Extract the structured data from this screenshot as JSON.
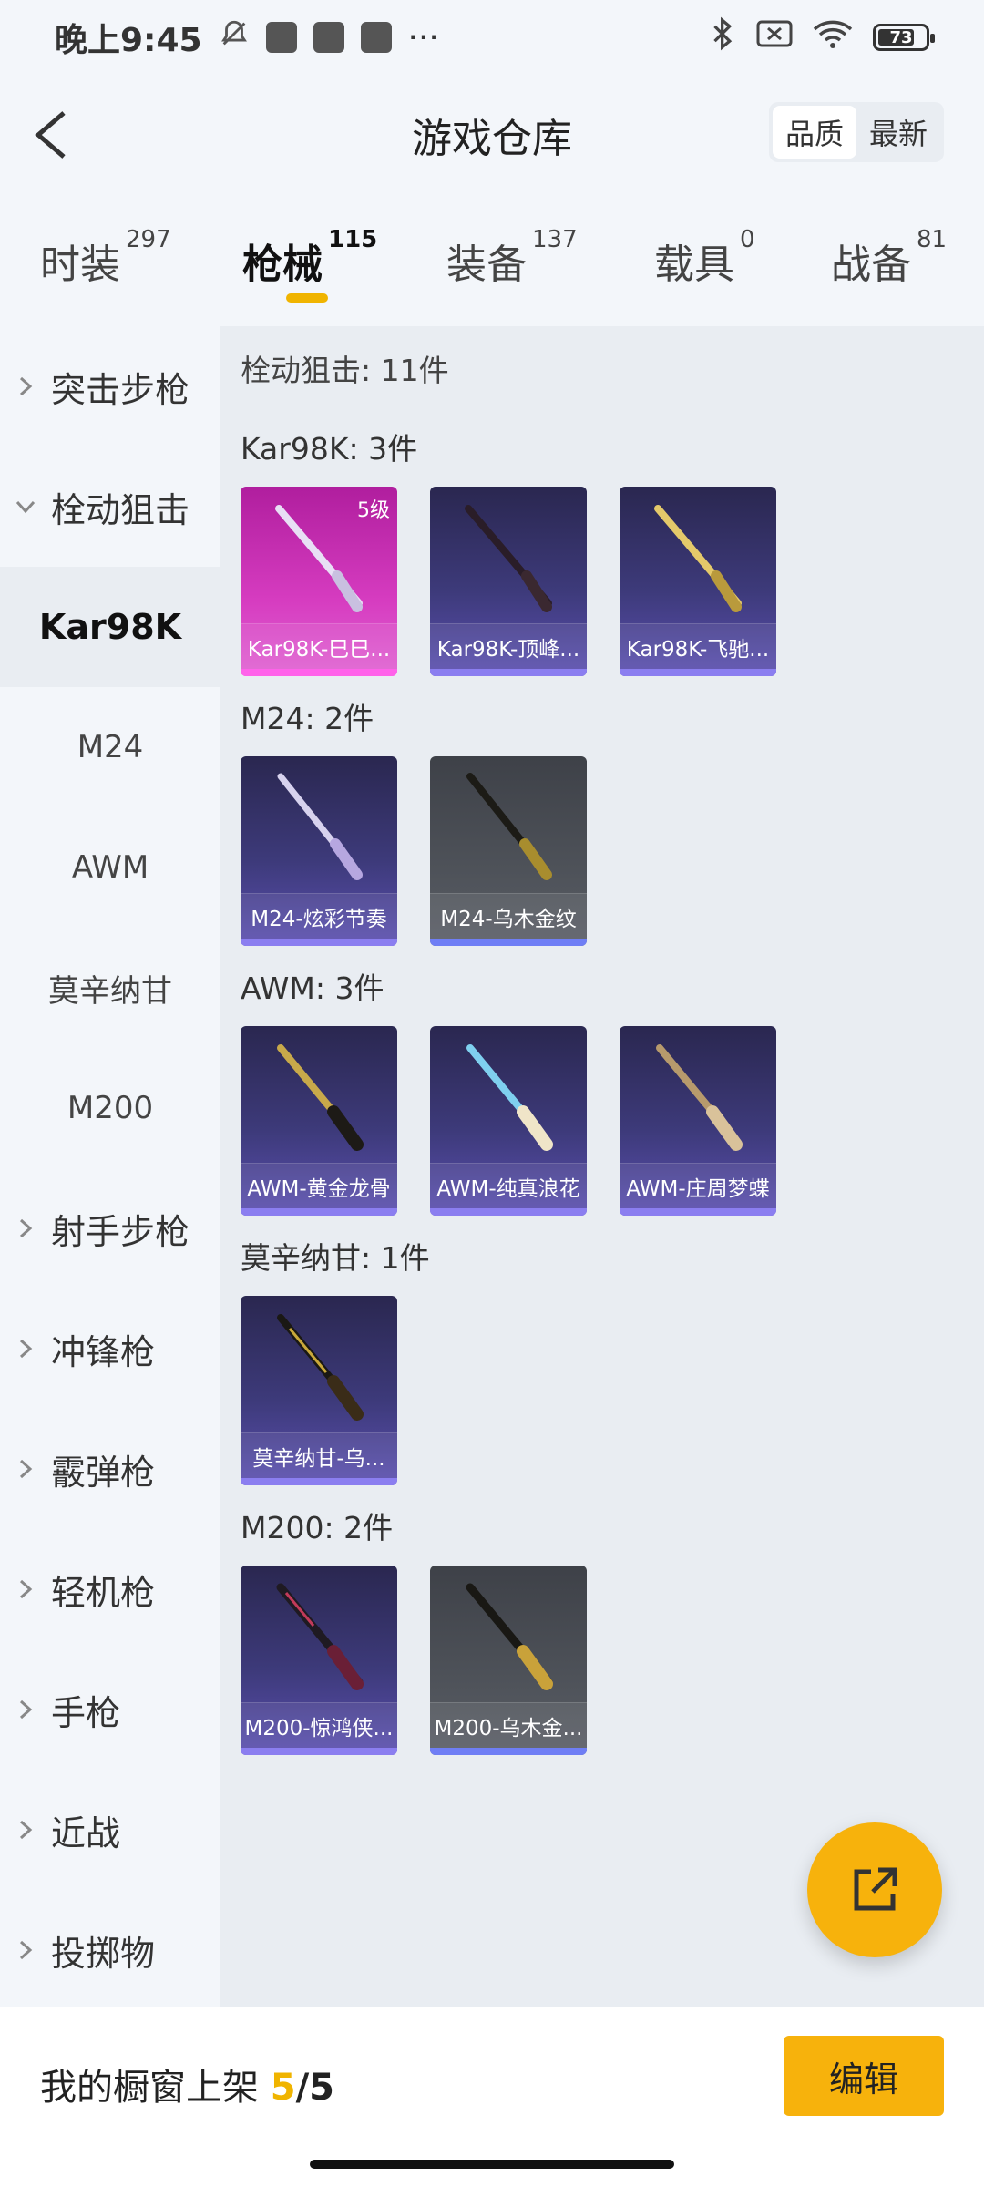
{
  "status_bar": {
    "time": "晚上9:45",
    "battery": "73",
    "more": "···"
  },
  "header": {
    "title": "游戏仓库",
    "sort": [
      "品质",
      "最新"
    ],
    "sort_active": 0
  },
  "tabs": [
    {
      "label": "时装",
      "count": "297"
    },
    {
      "label": "枪械",
      "count": "115",
      "active": true
    },
    {
      "label": "装备",
      "count": "137"
    },
    {
      "label": "载具",
      "count": "0"
    },
    {
      "label": "战备",
      "count": "81"
    }
  ],
  "sidebar": {
    "categories": [
      "突击步枪",
      "栓动狙击",
      "射手步枪",
      "冲锋枪",
      "霰弹枪",
      "轻机枪",
      "手枪",
      "近战",
      "投掷物"
    ],
    "sub_items": [
      "Kar98K",
      "M24",
      "AWM",
      "莫辛纳甘",
      "M200"
    ],
    "active_sub": "Kar98K"
  },
  "main": {
    "category_count": "栓动狙击: 11件",
    "groups": [
      {
        "title": "Kar98K: 3件",
        "items": [
          {
            "label": "Kar98K-巳巳...",
            "level": "5级",
            "quality": "gold"
          },
          {
            "label": "Kar98K-顶峰...",
            "quality": "purple"
          },
          {
            "label": "Kar98K-飞驰...",
            "quality": "purple"
          }
        ]
      },
      {
        "title": "M24: 2件",
        "items": [
          {
            "label": "M24-炫彩节奏",
            "quality": "purple"
          },
          {
            "label": "M24-乌木金纹",
            "quality": "grey"
          }
        ]
      },
      {
        "title": "AWM: 3件",
        "items": [
          {
            "label": "AWM-黄金龙骨",
            "quality": "purple"
          },
          {
            "label": "AWM-纯真浪花",
            "quality": "purple"
          },
          {
            "label": "AWM-庄周梦蝶",
            "quality": "purple"
          }
        ]
      },
      {
        "title": "莫辛纳甘: 1件",
        "items": [
          {
            "label": "莫辛纳甘-乌...",
            "quality": "purple"
          }
        ]
      },
      {
        "title": "M200: 2件",
        "items": [
          {
            "label": "M200-惊鸿侠...",
            "quality": "purple"
          },
          {
            "label": "M200-乌木金...",
            "quality": "grey"
          }
        ]
      }
    ]
  },
  "bottom": {
    "label": "我的橱窗上架 ",
    "current": "5",
    "sep": "/",
    "total": "5",
    "edit": "编辑"
  },
  "colors": {
    "accent": "#f7b20c",
    "bg": "#f3f6fa",
    "panel": "#e9edf2"
  }
}
